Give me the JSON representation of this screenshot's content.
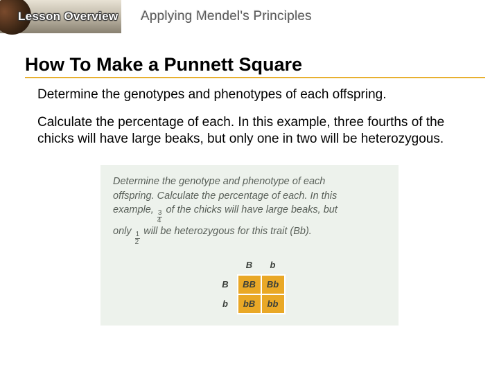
{
  "header": {
    "lesson_label": "Lesson Overview",
    "title": "Applying Mendel's Principles"
  },
  "heading": "How To Make a Punnett Square",
  "body": {
    "p1": "Determine the genotypes and phenotypes of each offspring.",
    "p2": "Calculate the percentage of each. In this example, three fourths of the chicks will have large beaks, but only one in two will be heterozygous."
  },
  "figure": {
    "line1": "Determine the genotype and phenotype of each",
    "line2": "offspring. Calculate the percentage of each. In this",
    "line3a": "example, ",
    "frac1_top": "3",
    "frac1_bot": "4",
    "line3b": " of the chicks will have large beaks, but",
    "line4a": "only ",
    "frac2_top": "1",
    "frac2_bot": "2",
    "line4b": " will be heterozygous for this trait ",
    "paren": "(Bb)."
  },
  "punnett": {
    "cols": [
      "B",
      "b"
    ],
    "rows": [
      "B",
      "b"
    ],
    "cells": [
      [
        "BB",
        "Bb"
      ],
      [
        "bB",
        "bb"
      ]
    ]
  }
}
